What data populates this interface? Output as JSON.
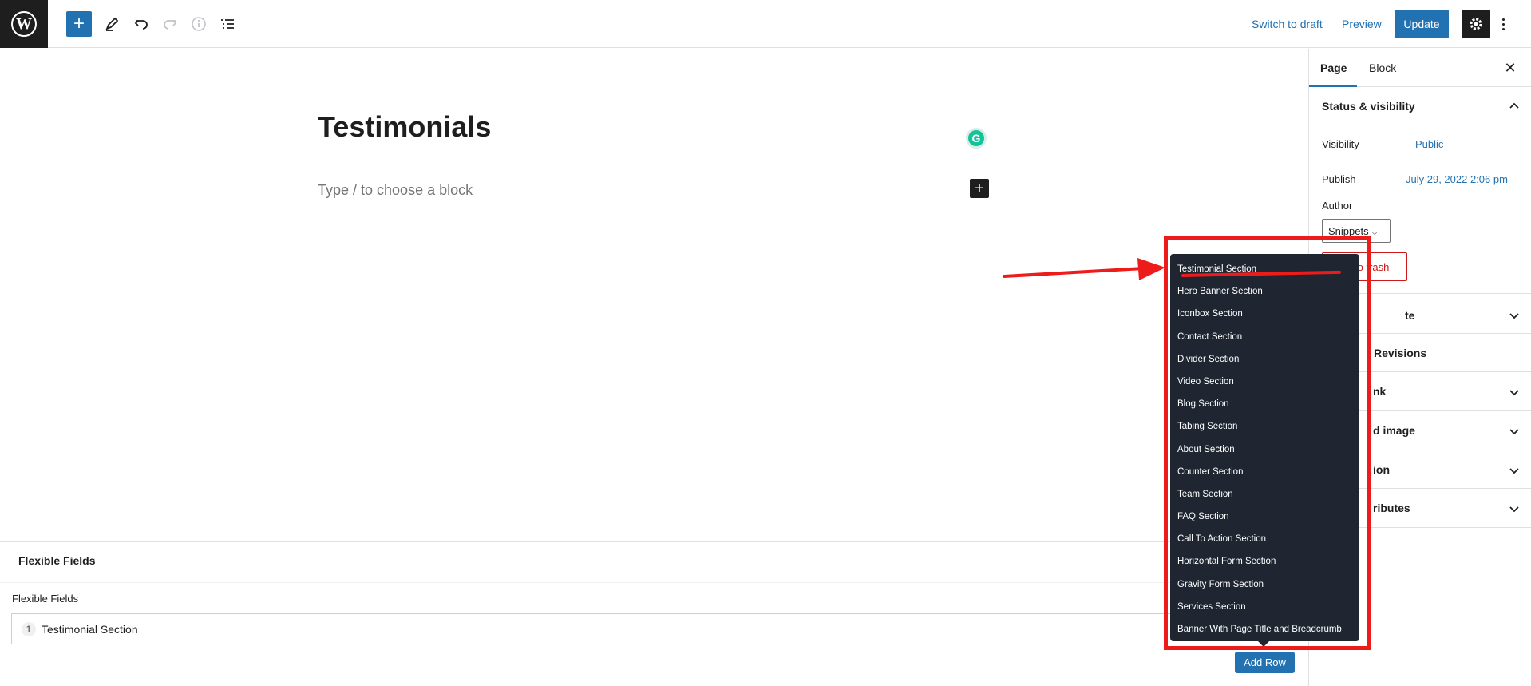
{
  "toolbar": {
    "switch_to_draft": "Switch to draft",
    "preview": "Preview",
    "update": "Update"
  },
  "editor": {
    "title": "Testimonials",
    "placeholder": "Type / to choose a block",
    "grammarly_glyph": "G"
  },
  "sidebar": {
    "tabs": [
      "Page",
      "Block"
    ],
    "active_tab": "Page",
    "status_panel": {
      "title": "Status & visibility",
      "visibility_label": "Visibility",
      "visibility_value": "Public",
      "publish_label": "Publish",
      "publish_value": "July 29, 2022 2:06 pm",
      "author_label": "Author",
      "author_value": "Snippets",
      "trash_visible": "to trash"
    },
    "collapsed_panels": [
      "te",
      "Revisions",
      "nk",
      "d image",
      "ion",
      "ributes"
    ]
  },
  "metabox": {
    "heading": "Flexible Fields",
    "field_label": "Flexible Fields",
    "rows": [
      {
        "num": "1",
        "label": "Testimonial Section"
      }
    ],
    "add_row": "Add Row"
  },
  "popup": {
    "items": [
      "Testimonial Section",
      "Hero Banner Section",
      "Iconbox Section",
      "Contact Section",
      "Divider Section",
      "Video Section",
      "Blog Section",
      "Tabing Section",
      "About Section",
      "Counter Section",
      "Team Section",
      "FAQ Section",
      "Call To Action Section",
      "Horizontal Form Section",
      "Gravity Form Section",
      "Services Section",
      "Banner With Page Title and Breadcrumb"
    ]
  },
  "colors": {
    "accent": "#2271b1",
    "dark": "#1e1e1e",
    "popup_bg": "#1f2631",
    "annotation_red": "#ee1b1b",
    "trash_red": "#cc1818"
  },
  "icons": [
    "wordpress-logo",
    "plus-icon",
    "pencil-icon",
    "undo-icon",
    "redo-icon",
    "info-icon",
    "list-view-icon",
    "gear-icon",
    "more-vertical-icon",
    "close-icon",
    "chevron-up-icon",
    "chevron-down-icon",
    "grammarly-icon"
  ]
}
